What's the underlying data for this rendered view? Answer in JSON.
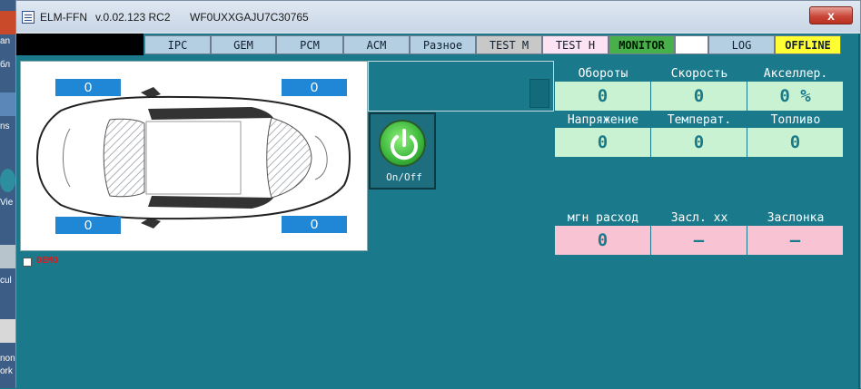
{
  "window": {
    "app_name": "ELM-FFN",
    "version": "v.0.02.123 RC2",
    "vin": "WF0UXXGAJU7C30765",
    "close_glyph": "x"
  },
  "desktop": {
    "fragments": [
      "an",
      "бл",
      "ns",
      "Vie",
      "cul",
      "non",
      "ork"
    ]
  },
  "tabs": [
    {
      "label": "IPC",
      "color": "#b4cfe2"
    },
    {
      "label": "GEM",
      "color": "#b4cfe2"
    },
    {
      "label": "PCM",
      "color": "#b4cfe2"
    },
    {
      "label": "ACM",
      "color": "#b4cfe2"
    },
    {
      "label": "Разное",
      "color": "#b4cfe2"
    },
    {
      "label": "TEST M",
      "color": "#c8c8c8"
    },
    {
      "label": "TEST H",
      "color": "#fbe3f3"
    },
    {
      "label": "MONITOR",
      "color": "#48b04a"
    },
    {
      "label": "",
      "color": "#ffffff"
    },
    {
      "label": "LOG",
      "color": "#b4cfe2"
    },
    {
      "label": "OFFLINE",
      "color": "#ffff33"
    }
  ],
  "tires": {
    "front_left": "0",
    "front_right": "0",
    "rear_left": "0",
    "rear_right": "0"
  },
  "power_button": {
    "label": "On/Off"
  },
  "gauges_row1": [
    {
      "label": "Обороты",
      "value": "0"
    },
    {
      "label": "Скорость",
      "value": "0"
    },
    {
      "label": "Акселлер.",
      "value": "0 %"
    }
  ],
  "gauges_row2": [
    {
      "label": "Напряжение",
      "value": "0"
    },
    {
      "label": "Температ.",
      "value": "0"
    },
    {
      "label": "Топливо",
      "value": "0"
    }
  ],
  "gauges_row3": [
    {
      "label": "мгн расход",
      "value": "0"
    },
    {
      "label": "Засл. хх",
      "value": "–"
    },
    {
      "label": "Заслонка",
      "value": "–"
    }
  ],
  "demo": {
    "label": "DEMO",
    "checked": false
  },
  "colors": {
    "background": "#1a7a8c",
    "tire_box": "#1f87d6",
    "value_green": "#c9f2d3",
    "value_pink": "#f8c4d4",
    "demo_text": "#e01a1a"
  }
}
